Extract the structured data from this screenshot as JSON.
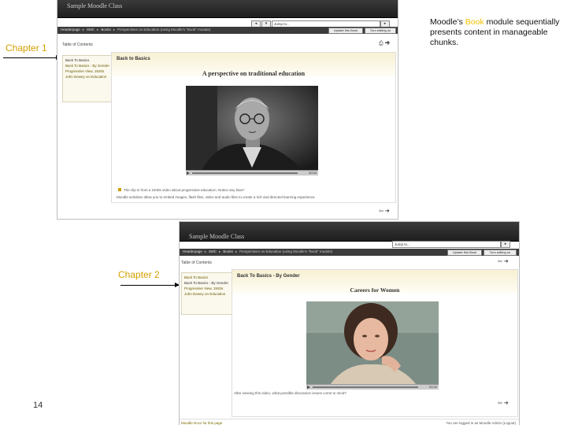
{
  "slide": {
    "caption": {
      "pre": "Moodle’s ",
      "highlight": "Book",
      "post": " module sequentially presents content in manageable chunks."
    },
    "chapter1_label": "Chapter 1",
    "chapter2_label": "Chapter 2",
    "page_number": "14"
  },
  "shot1": {
    "site_title": "Sample Moodle Class",
    "jump_value": "Jump to...",
    "breadcrumb": [
      "Headerpage",
      "SMC",
      "Books"
    ],
    "breadcrumb_current": "Perspectives on Education (using Moodle's \"Book\" module)",
    "update_button": "Update this Book",
    "turn_editing_button": "Turn editing on",
    "toc_label": "Table of Contents",
    "toc_items": [
      "Back To Basics",
      "Back To Basics - By Gender",
      "Progressive View, 1920s",
      "John Dewey on Education"
    ],
    "chapter_title": "Back to Basics",
    "subtitle": "A perspective on traditional education",
    "video_time": "00:00",
    "bullet_text": "The clip is from a 1940s video about progressive education. Notice any bias?",
    "description": "Moodle activities allow you to embed images, flash files, video and audio files to create a rich and directed learning experience."
  },
  "shot2": {
    "site_title": "Sample Moodle Class",
    "jump_value": "Jump to...",
    "breadcrumb": [
      "Headerpage",
      "SMC",
      "Books"
    ],
    "breadcrumb_current": "Perspectives on Education (using Moodle's \"Book\" module)",
    "update_button": "Update this Book",
    "turn_editing_button": "Turn editing on",
    "toc_label": "Table of Contents",
    "toc_items": [
      "Back To Basics",
      "Back To Basics - By Gender",
      "Progressive View, 1920s",
      "John Dewey on Education"
    ],
    "chapter_title": "Back To Basics - By Gender",
    "subtitle": "Careers for Women",
    "video_time": "00:00",
    "question": "After viewing this video, what possible discussion issues come to mind?",
    "footer_left": "Moodle Docs for this page",
    "footer_right": "You are logged in as Moodle Admin (Logout)"
  }
}
